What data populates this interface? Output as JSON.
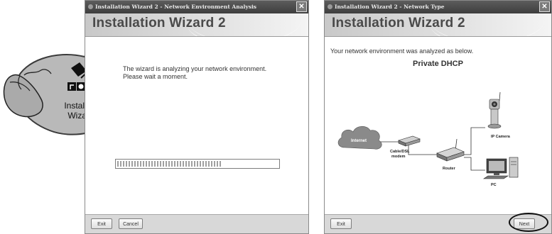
{
  "left_window": {
    "title": "Installation Wizard 2 - Network Environment Analysis",
    "header_title": "Installation Wizard 2",
    "message_line1": "The wizard is analyzing your network environment.",
    "message_line2": "Please wait a moment.",
    "progress_percent": 65,
    "buttons": {
      "exit": "Exit",
      "cancel": "Cancel"
    }
  },
  "right_window": {
    "title": "Installation Wizard 2 - Network Type",
    "header_title": "Installation Wizard 2",
    "message": "Your network environment was analyzed as below.",
    "network_type": "Private DHCP",
    "diagram_labels": {
      "internet": "Internet",
      "modem_line1": "Cable/DSL",
      "modem_line2": "modem",
      "router": "Router",
      "camera": "IP Camera",
      "pc": "PC"
    },
    "buttons": {
      "exit": "Exit",
      "next": "Next"
    }
  },
  "callout": {
    "label_line1": "Installation",
    "label_line2": "Wizard 2"
  },
  "colors": {
    "title_bar": "#4a4a4a",
    "header_bg": "#d9d9d9",
    "header_text": "#4a4a4a",
    "callout_bg": "#b9b9b9",
    "footer_bg": "#d8d8d8"
  }
}
